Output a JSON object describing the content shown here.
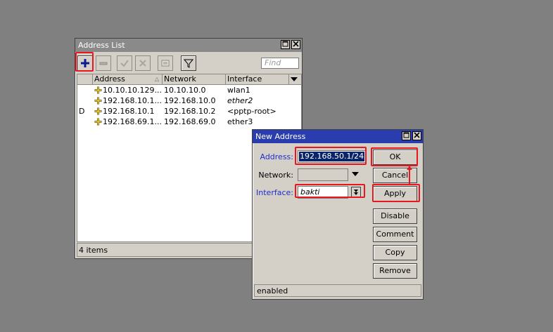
{
  "address_list": {
    "title": "Address List",
    "find_placeholder": "Find",
    "columns": [
      "Address",
      "Network",
      "Interface"
    ],
    "sort_indicator": "△",
    "rows": [
      {
        "flag": "",
        "address": "10.10.10.129...",
        "network": "10.10.10.0",
        "interface": "wlan1",
        "italic": false
      },
      {
        "flag": "",
        "address": "192.168.10.1...",
        "network": "192.168.10.0",
        "interface": "ether2",
        "italic": true
      },
      {
        "flag": "D",
        "address": "192.168.10.1",
        "network": "192.168.10.2",
        "interface": "<pptp-root>",
        "italic": false
      },
      {
        "flag": "",
        "address": "192.168.69.1...",
        "network": "192.168.69.0",
        "interface": "ether3",
        "italic": false
      }
    ],
    "status": "4 items"
  },
  "new_address": {
    "title": "New Address",
    "address_label": "Address:",
    "address_value": "192.168.50.1/24",
    "network_label": "Network:",
    "network_value": "",
    "interface_label": "Interface:",
    "interface_value": "bakti",
    "buttons": [
      "OK",
      "Cancel",
      "Apply",
      "Disable",
      "Comment",
      "Copy",
      "Remove"
    ],
    "status": "enabled"
  },
  "colors": {
    "highlight": "#e8161f",
    "active_title": "#2a3dae",
    "inactive_title": "#8a8a8a",
    "selection": "#0a246a"
  },
  "icons": [
    "plus-icon",
    "minus-icon",
    "check-icon",
    "cross-icon",
    "comment-icon",
    "filter-icon",
    "plus-entry-icon",
    "dropdown-arrow-icon"
  ]
}
